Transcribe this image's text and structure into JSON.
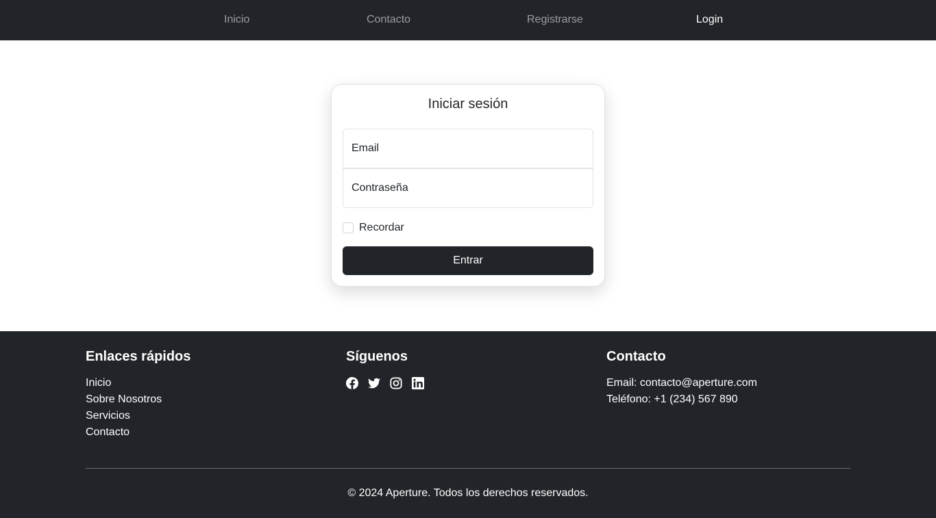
{
  "navbar": {
    "items": [
      {
        "label": "Inicio"
      },
      {
        "label": "Contacto"
      },
      {
        "label": "Registrarse"
      },
      {
        "label": "Login"
      }
    ],
    "active": "Login"
  },
  "login": {
    "title": "Iniciar sesión",
    "email_label": "Email",
    "password_label": "Contraseña",
    "remember_label": "Recordar",
    "remember_checked": false,
    "submit_label": "Entrar"
  },
  "footer": {
    "quick_links": {
      "heading": "Enlaces rápidos",
      "items": [
        "Inicio",
        "Sobre Nosotros",
        "Servicios",
        "Contacto"
      ]
    },
    "social": {
      "heading": "Síguenos",
      "icons": [
        "facebook-icon",
        "twitter-icon",
        "instagram-icon",
        "linkedin-icon"
      ]
    },
    "contact": {
      "heading": "Contacto",
      "email_line": "Email: contacto@aperture.com",
      "phone_line": "Teléfono: +1 (234) 567 890"
    },
    "copyright": "© 2024 Aperture. Todos los derechos reservados."
  },
  "colors": {
    "dark": "#212529",
    "nav_inactive": "rgba(255,255,255,0.55)",
    "white": "#ffffff",
    "border": "#dee2e6"
  }
}
